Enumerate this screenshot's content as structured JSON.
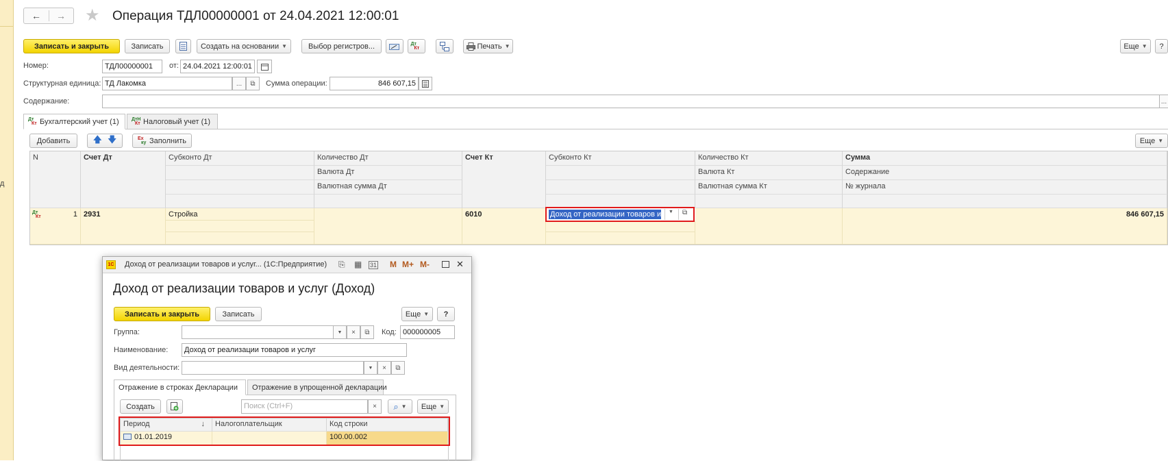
{
  "window": {
    "title": "Операция ТДЛ00000001 от 24.04.2021 12:00:01",
    "nav_back": "←",
    "nav_forward": "→",
    "star": "★"
  },
  "left_panel": {
    "glyph": "д"
  },
  "toolbar": {
    "save_close": "Записать и закрыть",
    "save": "Записать",
    "create_based": "Создать на основании",
    "select_registers": "Выбор регистров...",
    "print": "Печать",
    "more": "Еще",
    "help": "?"
  },
  "form": {
    "number_label": "Номер:",
    "number_value": "ТДЛ00000001",
    "from_label": "от:",
    "date_value": "24.04.2021 12:00:01",
    "unit_label": "Структурная единица:",
    "unit_value": "ТД Лакомка",
    "sum_label": "Сумма операции:",
    "sum_value": "846 607,15",
    "content_label": "Содержание:",
    "content_value": "",
    "ellipsis": "..."
  },
  "tabs": [
    {
      "label": "Бухгалтерский учет (1)"
    },
    {
      "label": "Налоговый учет (1)"
    }
  ],
  "grid_toolbar": {
    "add": "Добавить",
    "fill": "Заполнить",
    "more": "Еще"
  },
  "grid": {
    "headers": {
      "n": "N",
      "debit_account": "Счет Дт",
      "subconto_dt": "Субконто Дт",
      "qty_dt": "Количество Дт",
      "currency_dt": "Валюта Дт",
      "currency_sum_dt": "Валютная сумма Дт",
      "credit_account": "Счет Кт",
      "subconto_kt": "Субконто Кт",
      "qty_kt": "Количество Кт",
      "currency_kt": "Валюта Кт",
      "currency_sum_kt": "Валютная сумма Кт",
      "sum": "Сумма",
      "content": "Содержание",
      "journal": "№ журнала"
    },
    "rows": [
      {
        "n": "1",
        "debit_account": "2931",
        "subconto_dt": "Стройка",
        "credit_account": "6010",
        "subconto_kt": "Доход от реализации товаров и",
        "sum": "846 607,15"
      }
    ]
  },
  "modal": {
    "header_title": "Доход от реализации товаров и услуг...  (1С:Предприятие)",
    "header_icons": {
      "m": "M",
      "mplus": "M+",
      "mminus": "M-",
      "close": "✕"
    },
    "title": "Доход от реализации товаров и услуг (Доход)",
    "toolbar": {
      "save_close": "Записать и закрыть",
      "save": "Записать",
      "more": "Еще",
      "help": "?"
    },
    "group_label": "Группа:",
    "group_value": "",
    "code_label": "Код:",
    "code_value": "000000005",
    "name_label": "Наименование:",
    "name_value": "Доход от реализации товаров и услуг",
    "activity_label": "Вид деятельности:",
    "activity_value": "",
    "tabs": [
      {
        "label": "Отражение в строках Декларации"
      },
      {
        "label": "Отражение в упрощенной декларации"
      }
    ],
    "inner_toolbar": {
      "create": "Создать",
      "search_placeholder": "Поиск (Ctrl+F)",
      "more": "Еще"
    },
    "table": {
      "headers": {
        "period": "Период",
        "sort": "↓",
        "taxpayer": "Налогоплательщик",
        "line_code": "Код строки"
      },
      "rows": [
        {
          "period": "01.01.2019",
          "taxpayer": "",
          "line_code": "100.00.002"
        }
      ]
    }
  },
  "colors": {
    "accent_yellow": "#f3d400",
    "highlight_red": "#e01a1a",
    "selection_blue": "#3465c4",
    "row_yellow": "#fdf5d8"
  }
}
